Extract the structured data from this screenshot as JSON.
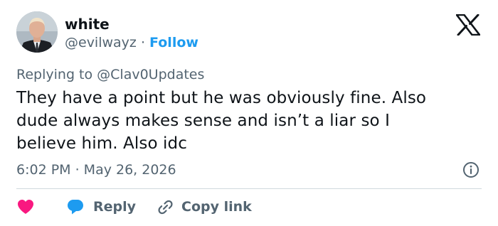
{
  "author": {
    "name": "white",
    "handle": "@evilwayz",
    "separator": "·",
    "follow_label": "Follow",
    "avatar_icon": "person-avatar"
  },
  "platform_icon": "x-logo-icon",
  "reply_context": {
    "text": "Replying to @Clav0Updates"
  },
  "tweet": {
    "lines": [
      "They have a point but he was obviously fine. Also",
      "dude always makes sense and isn’t a liar so I",
      "believe him. Also idc"
    ],
    "timestamp": "6:02 PM · May 26, 2026"
  },
  "actions": {
    "like_icon": "heart-icon",
    "reply_label": "Reply",
    "reply_icon": "speech-bubble-icon",
    "copy_label": "Copy link",
    "copy_icon": "link-icon"
  },
  "colors": {
    "text": "#0f1419",
    "secondary": "#536471",
    "accent": "#1d9bf0",
    "like": "#f91880",
    "divider": "#cfd9de"
  }
}
